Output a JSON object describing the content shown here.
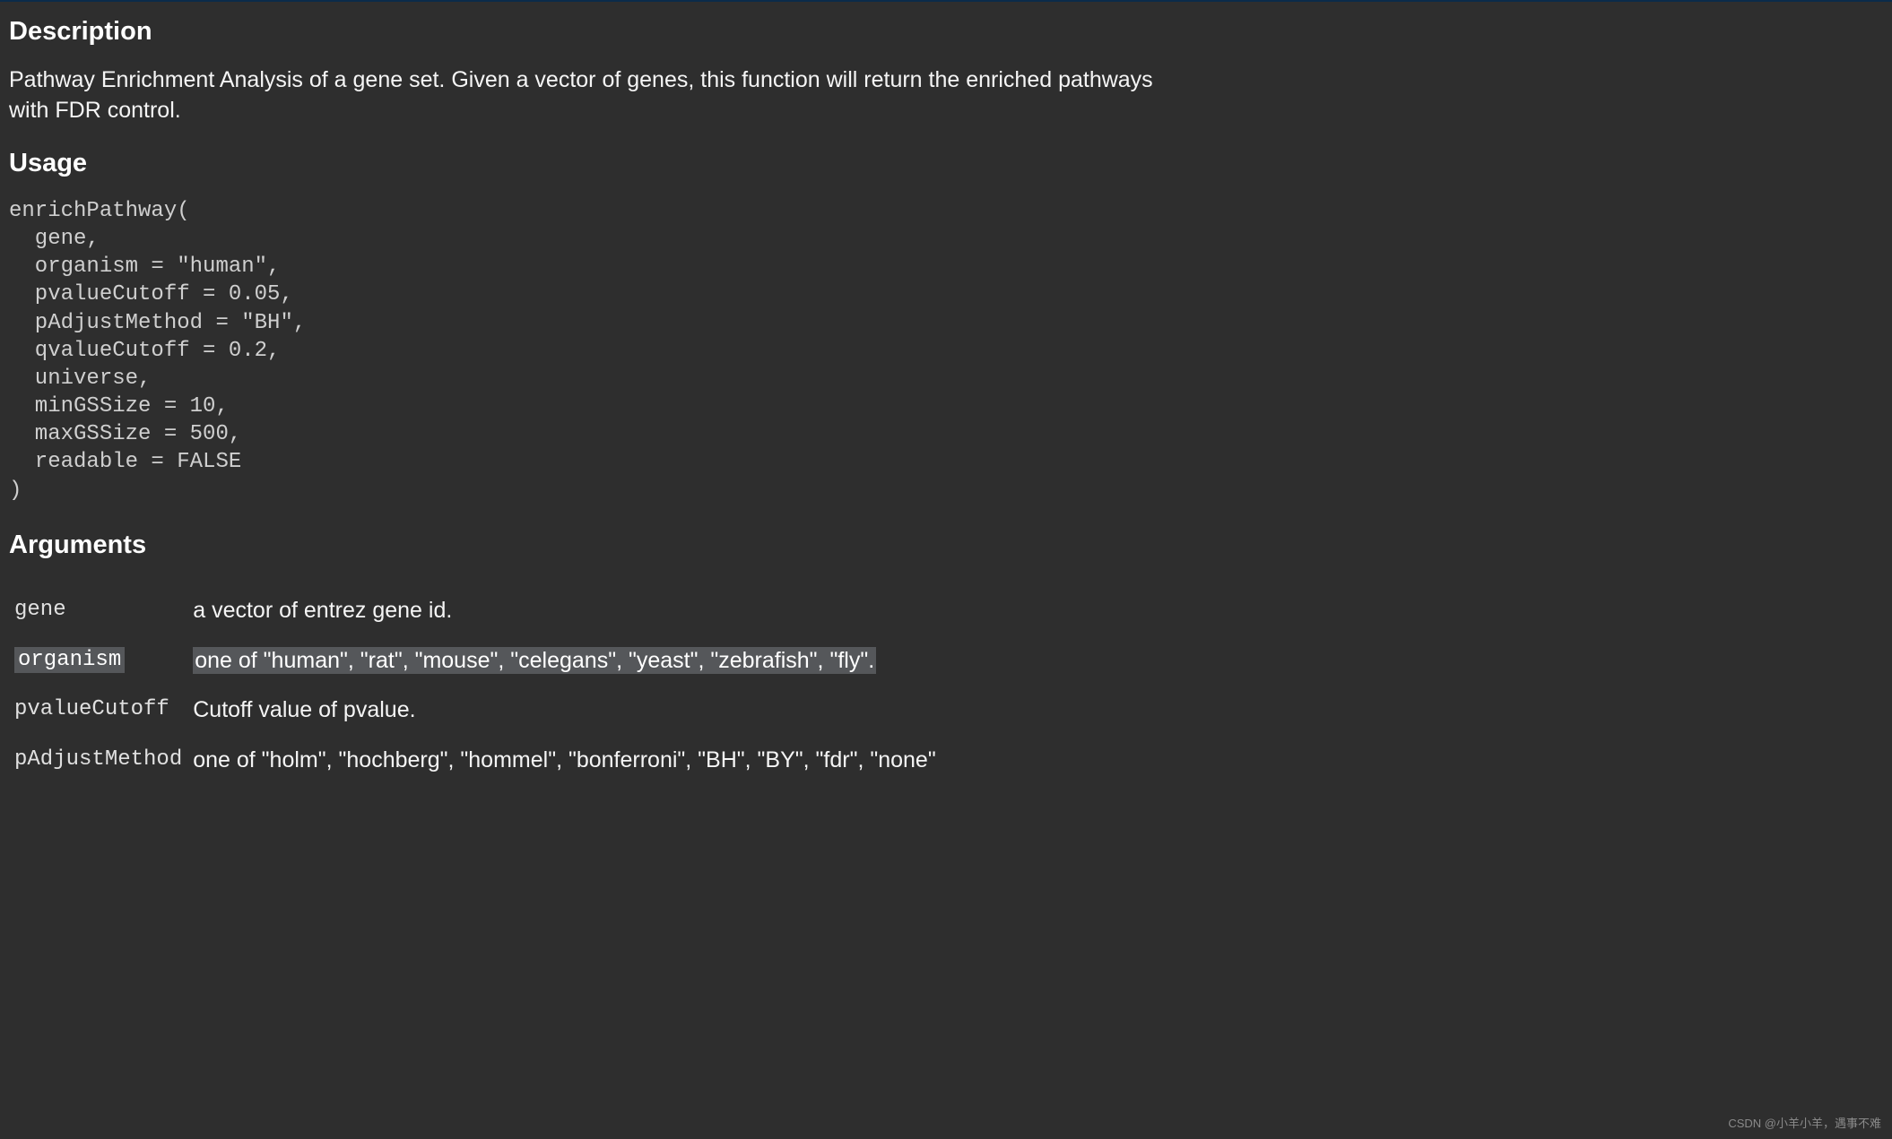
{
  "headings": {
    "description": "Description",
    "usage": "Usage",
    "arguments": "Arguments"
  },
  "description_text": "Pathway Enrichment Analysis of a gene set. Given a vector of genes, this function will return the enriched pathways with FDR control.",
  "usage_code": "enrichPathway(\n  gene,\n  organism = \"human\",\n  pvalueCutoff = 0.05,\n  pAdjustMethod = \"BH\",\n  qvalueCutoff = 0.2,\n  universe,\n  minGSSize = 10,\n  maxGSSize = 500,\n  readable = FALSE\n)",
  "arguments": [
    {
      "name": "gene",
      "desc": "a vector of entrez gene id.",
      "highlight": false
    },
    {
      "name": "organism",
      "desc": "one of \"human\", \"rat\", \"mouse\", \"celegans\", \"yeast\", \"zebrafish\", \"fly\".",
      "highlight": true
    },
    {
      "name": "pvalueCutoff",
      "desc": "Cutoff value of pvalue.",
      "highlight": false
    },
    {
      "name": "pAdjustMethod",
      "desc": "one of \"holm\", \"hochberg\", \"hommel\", \"bonferroni\", \"BH\", \"BY\", \"fdr\", \"none\"",
      "highlight": false
    }
  ],
  "watermark": "CSDN @小羊小羊，遇事不难"
}
